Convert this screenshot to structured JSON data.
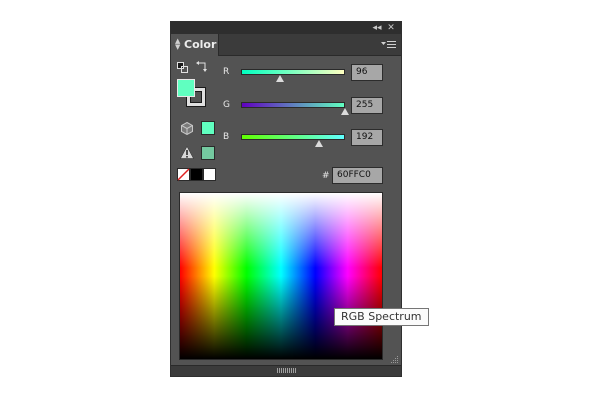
{
  "panel": {
    "tab_label": "Color",
    "collapse_glyph": "◂◂",
    "close_glyph": "✕",
    "menu_icon": "panel-menu-icon"
  },
  "colors": {
    "fill": "#60FFC0",
    "stroke": "#ffffff",
    "out_of_web_swatch": "#60ffc0",
    "out_of_gamut_swatch": "#74c9a0"
  },
  "channels": {
    "r": {
      "label": "R",
      "value": "96",
      "fraction": 0.376
    },
    "g": {
      "label": "G",
      "value": "255",
      "fraction": 1.0
    },
    "b": {
      "label": "B",
      "value": "192",
      "fraction": 0.753
    }
  },
  "hex": {
    "symbol": "#",
    "value": "60FFC0"
  },
  "spectrum": {
    "tooltip": "RGB Spectrum"
  }
}
